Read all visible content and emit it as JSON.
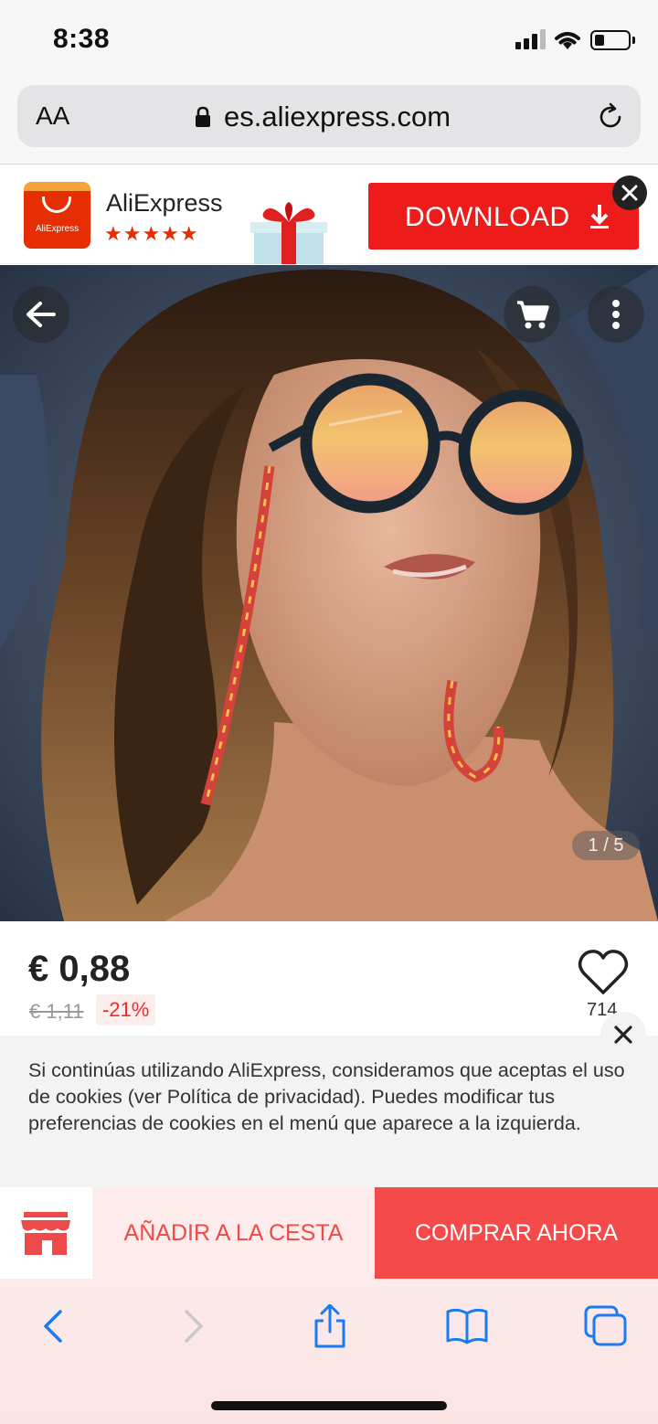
{
  "status_bar": {
    "time": "8:38"
  },
  "browser": {
    "text_size": "AA",
    "url": "es.aliexpress.com"
  },
  "app_banner": {
    "logo_text": "AliExpress",
    "app_name": "AliExpress",
    "stars": "★★★★★",
    "rating": 4.5,
    "download_label": "DOWNLOAD"
  },
  "hero": {
    "pager": "1 / 5"
  },
  "product": {
    "price": "€ 0,88",
    "old_price": "€ 1,11",
    "discount": "-21%",
    "wish_count": "714"
  },
  "cookie_notice": {
    "text": "Si continúas utilizando AliExpress, consideramos que aceptas el uso de cookies (ver Política de privacidad). Puedes modificar tus preferencias de cookies en el menú que aparece a la izquierda."
  },
  "actions": {
    "add_to_cart": "AÑADIR A LA CESTA",
    "buy_now": "COMPRAR AHORA"
  },
  "colors": {
    "brand_red": "#ee1b1b",
    "accent_red": "#f44a4a",
    "ios_blue": "#1a7cf5"
  }
}
